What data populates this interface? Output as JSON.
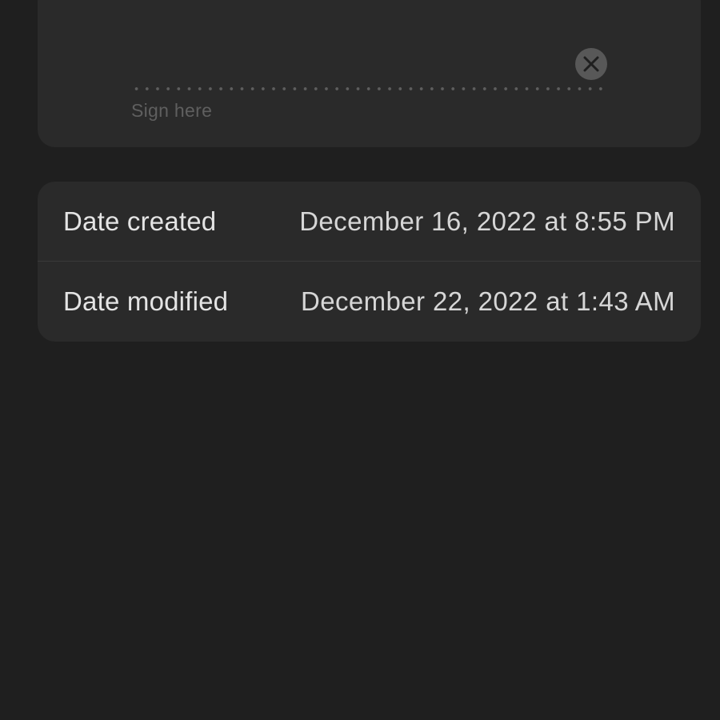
{
  "signature": {
    "placeholder": "Sign here",
    "clear_icon": "close-icon"
  },
  "info": {
    "rows": [
      {
        "label": "Date created",
        "value": "December 16, 2022 at 8:55 PM"
      },
      {
        "label": "Date modified",
        "value": "December 22, 2022 at 1:43 AM"
      }
    ]
  },
  "colors": {
    "background": "#1f1f1f",
    "card": "#2a2a2a",
    "text_primary": "#e4e4e4",
    "text_placeholder": "#5f5f5f",
    "clear_button": "#585858"
  }
}
